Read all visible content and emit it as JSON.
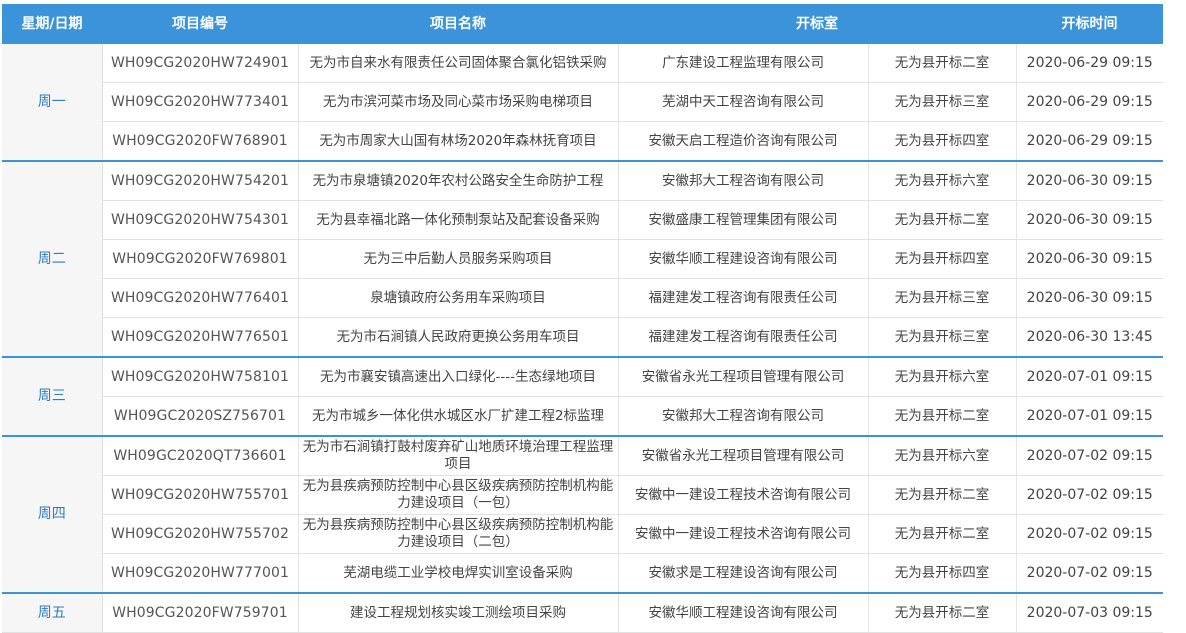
{
  "table": {
    "headers": [
      "星期/日期",
      "项目编号",
      "项目名称",
      "开标室",
      "开标时间"
    ],
    "groups": [
      {
        "day": "周一",
        "rows": [
          {
            "id": "WH09CG2020HW724901",
            "name": "无为市自来水有限责任公司固体聚合氯化铝铁采购",
            "agency": "广东建设工程监理有限公司",
            "room": "无为县开标二室",
            "time": "2020-06-29 09:15"
          },
          {
            "id": "WH09CG2020HW773401",
            "name": "无为市滨河菜市场及同心菜市场采购电梯项目",
            "agency": "芜湖中天工程咨询有限公司",
            "room": "无为县开标三室",
            "time": "2020-06-29 09:15"
          },
          {
            "id": "WH09CG2020FW768901",
            "name": "无为市周家大山国有林场2020年森林抚育项目",
            "agency": "安徽天启工程造价咨询有限公司",
            "room": "无为县开标四室",
            "time": "2020-06-29 09:15"
          }
        ]
      },
      {
        "day": "周二",
        "rows": [
          {
            "id": "WH09CG2020HW754201",
            "name": "无为市泉塘镇2020年农村公路安全生命防护工程",
            "agency": "安徽邦大工程咨询有限公司",
            "room": "无为县开标六室",
            "time": "2020-06-30 09:15"
          },
          {
            "id": "WH09CG2020HW754301",
            "name": "无为县幸福北路一体化预制泵站及配套设备采购",
            "agency": "安徽盛康工程管理集团有限公司",
            "room": "无为县开标二室",
            "time": "2020-06-30 09:15"
          },
          {
            "id": "WH09CG2020FW769801",
            "name": "无为三中后勤人员服务采购项目",
            "agency": "安徽华顺工程建设咨询有限公司",
            "room": "无为县开标四室",
            "time": "2020-06-30 09:15"
          },
          {
            "id": "WH09CG2020HW776401",
            "name": "泉塘镇政府公务用车采购项目",
            "agency": "福建建发工程咨询有限责任公司",
            "room": "无为县开标三室",
            "time": "2020-06-30 09:15"
          },
          {
            "id": "WH09CG2020HW776501",
            "name": "无为市石涧镇人民政府更换公务用车项目",
            "agency": "福建建发工程咨询有限责任公司",
            "room": "无为县开标三室",
            "time": "2020-06-30 13:45"
          }
        ]
      },
      {
        "day": "周三",
        "rows": [
          {
            "id": "WH09CG2020HW758101",
            "name": "无为市襄安镇高速出入口绿化----生态绿地项目",
            "agency": "安徽省永光工程项目管理有限公司",
            "room": "无为县开标六室",
            "time": "2020-07-01 09:15"
          },
          {
            "id": "WH09GC2020SZ756701",
            "name": "无为市城乡一体化供水城区水厂扩建工程2标监理",
            "agency": "安徽邦大工程咨询有限公司",
            "room": "无为县开标二室",
            "time": "2020-07-01 09:15"
          }
        ]
      },
      {
        "day": "周四",
        "rows": [
          {
            "id": "WH09GC2020QT736601",
            "name": "无为市石涧镇打鼓村废弃矿山地质环境治理工程监理项目",
            "agency": "安徽省永光工程项目管理有限公司",
            "room": "无为县开标六室",
            "time": "2020-07-02 09:15"
          },
          {
            "id": "WH09CG2020HW755701",
            "name": "无为县疾病预防控制中心县区级疾病预防控制机构能力建设项目（一包）",
            "agency": "安徽中一建设工程技术咨询有限公司",
            "room": "无为县开标二室",
            "time": "2020-07-02 09:15"
          },
          {
            "id": "WH09CG2020HW755702",
            "name": "无为县疾病预防控制中心县区级疾病预防控制机构能力建设项目（二包）",
            "agency": "安徽中一建设工程技术咨询有限公司",
            "room": "无为县开标二室",
            "time": "2020-07-02 09:15"
          },
          {
            "id": "WH09CG2020HW777001",
            "name": "芜湖电缆工业学校电焊实训室设备采购",
            "agency": "安徽求是工程建设咨询有限公司",
            "room": "无为县开标四室",
            "time": "2020-07-02 09:15"
          }
        ]
      },
      {
        "day": "周五",
        "rows": [
          {
            "id": "WH09CG2020FW759701",
            "name": "建设工程规划核实竣工测绘项目采购",
            "agency": "安徽华顺工程建设咨询有限公司",
            "room": "无为县开标二室",
            "time": "2020-07-03 09:15"
          }
        ]
      }
    ]
  }
}
